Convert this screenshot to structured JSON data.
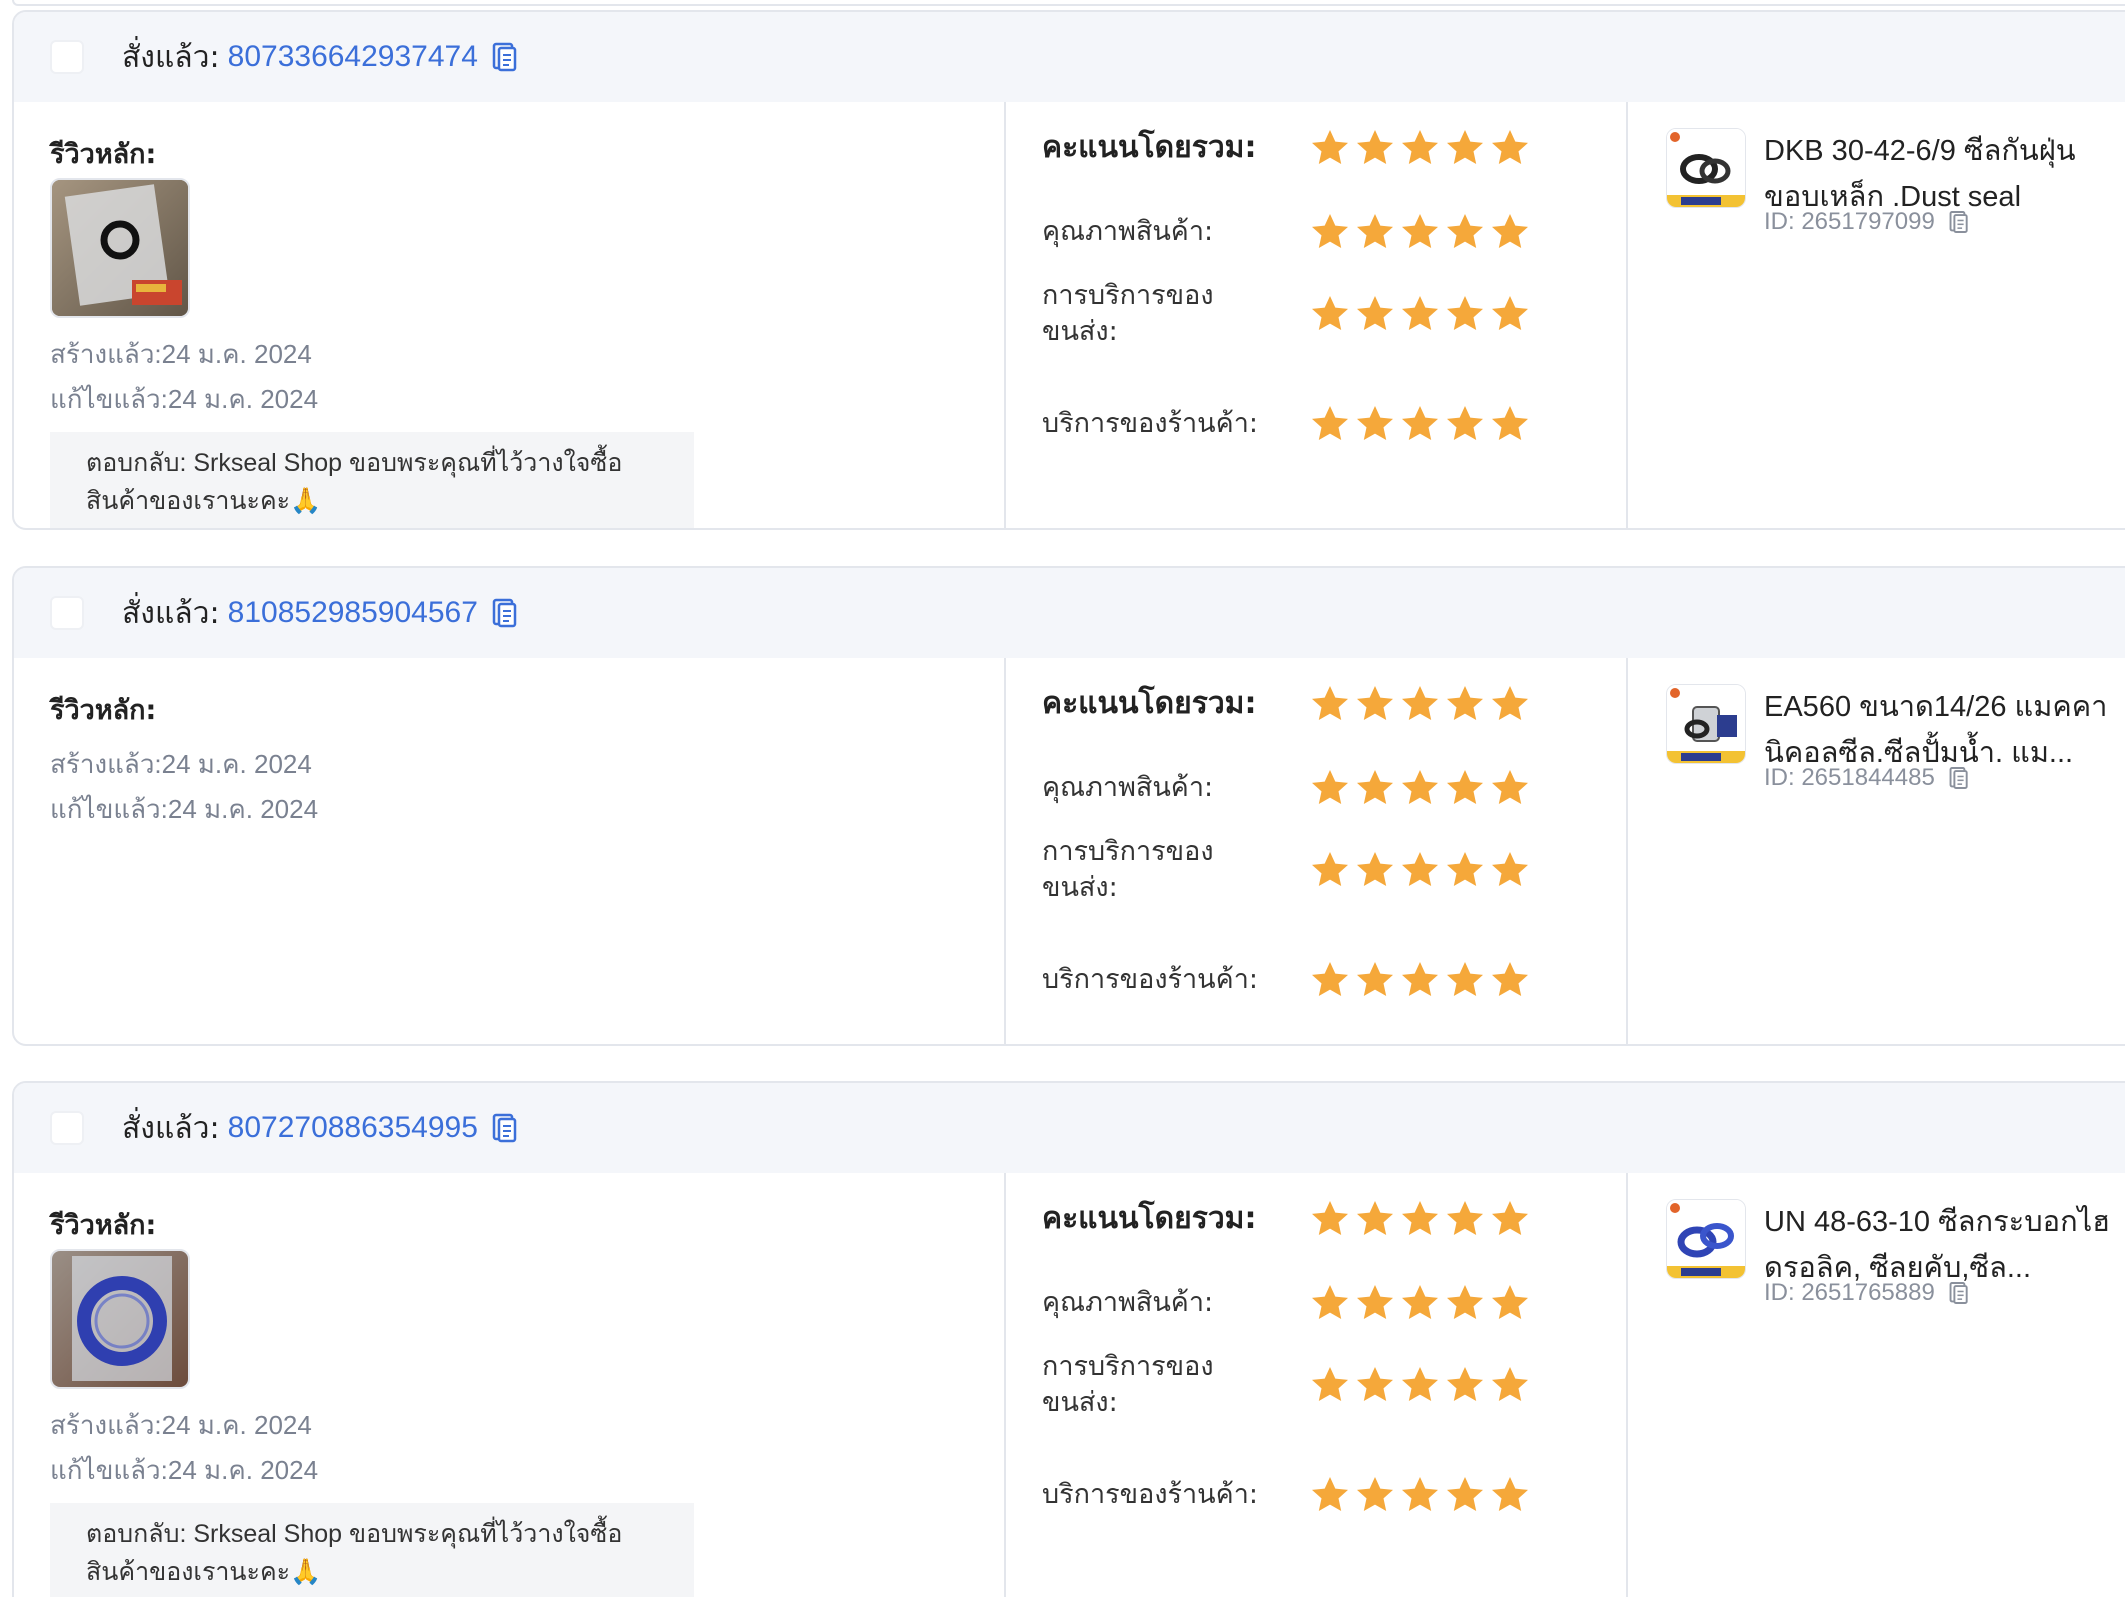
{
  "labels": {
    "ordered": "สั่งแล้ว:",
    "main_review": "รีวิวหลัก:",
    "overall": "คะแนนโดยรวม:",
    "product_quality": "คุณภาพสินค้า:",
    "shipping_service_line1": "การบริการของ",
    "shipping_service_line2": "ขนส่ง:",
    "shop_service": "บริการของร้านค้า:"
  },
  "colors": {
    "star": "#F5A83A",
    "link": "#3B6FD9",
    "header_bg": "#F4F6FA"
  },
  "reviews": [
    {
      "order_id": "807336642937474",
      "created": "สร้างแล้ว:24 ม.ค. 2024",
      "edited": "แก้ไขแล้ว:24 ม.ค. 2024",
      "reply": "ตอบกลับ: Srkseal Shop ขอบพระคุณที่ไว้วางใจซื้อสินค้าของเรานะคะ🙏",
      "ratings": {
        "overall": 5,
        "product_quality": 5,
        "shipping_service": 5,
        "shop_service": 5
      },
      "product_name": "DKB 30-42-6/9 ซีลกันฝุ่น ขอบเหล็ก .Dust seal",
      "product_id": "ID: 2651797099"
    },
    {
      "order_id": "810852985904567",
      "created": "สร้างแล้ว:24 ม.ค. 2024",
      "edited": "แก้ไขแล้ว:24 ม.ค. 2024",
      "ratings": {
        "overall": 5,
        "product_quality": 5,
        "shipping_service": 5,
        "shop_service": 5
      },
      "product_name": "EA560 ขนาด14/26 แมคคานิคอลซีล.ซีลปั้มน้ำ. แม...",
      "product_id": "ID: 2651844485"
    },
    {
      "order_id": "807270886354995",
      "created": "สร้างแล้ว:24 ม.ค. 2024",
      "edited": "แก้ไขแล้ว:24 ม.ค. 2024",
      "reply": "ตอบกลับ: Srkseal Shop ขอบพระคุณที่ไว้วางใจซื้อสินค้าของเรานะคะ🙏",
      "ratings": {
        "overall": 5,
        "product_quality": 5,
        "shipping_service": 5,
        "shop_service": 5
      },
      "product_name": "UN 48-63-10 ซีลกระบอกไฮดรอลิค, ซีลยคับ,ซีล...",
      "product_id": "ID: 2651765889"
    }
  ]
}
